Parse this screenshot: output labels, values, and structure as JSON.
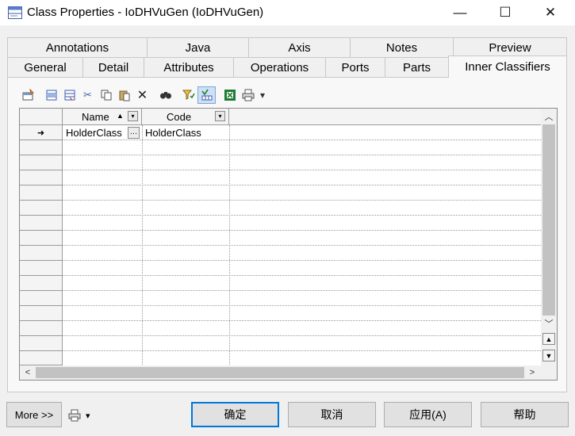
{
  "window": {
    "title": "Class Properties - IoDHVuGen (IoDHVuGen)",
    "minimize_glyph": "—",
    "maximize_glyph": "☐",
    "close_glyph": "✕",
    "icon": "class-properties-icon"
  },
  "tabs_row1": [
    {
      "label": "Annotations"
    },
    {
      "label": "Java"
    },
    {
      "label": "Axis"
    },
    {
      "label": "Notes"
    },
    {
      "label": "Preview"
    }
  ],
  "tabs_row2": [
    {
      "label": "General"
    },
    {
      "label": "Detail"
    },
    {
      "label": "Attributes"
    },
    {
      "label": "Operations"
    },
    {
      "label": "Ports"
    },
    {
      "label": "Parts"
    },
    {
      "label": "Inner Classifiers",
      "active": true
    }
  ],
  "toolbar": {
    "icons": [
      "properties-icon",
      "insert-row-icon",
      "add-row-icon",
      "cut-icon",
      "copy-icon",
      "paste-icon",
      "delete-icon",
      "find-icon",
      "filter-icon",
      "customize-columns-icon",
      "excel-export-icon",
      "print-icon",
      "dropdown-arrow-icon"
    ],
    "glyphs": {
      "cut": "✂",
      "delete": "✕",
      "find": "⌕",
      "dropdown": "▾"
    }
  },
  "grid": {
    "columns": [
      {
        "label": "Name",
        "sort_glyph": "▲",
        "menu_glyph": "▾"
      },
      {
        "label": "Code",
        "menu_glyph": "▾"
      }
    ],
    "rows": [
      {
        "marker": "➜",
        "name": "HolderClass",
        "code": "HolderClass"
      }
    ],
    "ellipsis_glyph": "…",
    "scroll_glyphs": {
      "up": "︿",
      "down": "﹀",
      "left": "<",
      "right": ">",
      "move_up": "▲",
      "move_down": "▼"
    }
  },
  "footer": {
    "more_label": "More >>",
    "print_dropdown_glyph": "▾",
    "ok_label": "确定",
    "cancel_label": "取消",
    "apply_label": "应用(A)",
    "help_label": "帮助"
  },
  "colors": {
    "accent": "#0078d7",
    "scroll_thumb": "#c2c2c2",
    "excel_green": "#1e7b34"
  }
}
